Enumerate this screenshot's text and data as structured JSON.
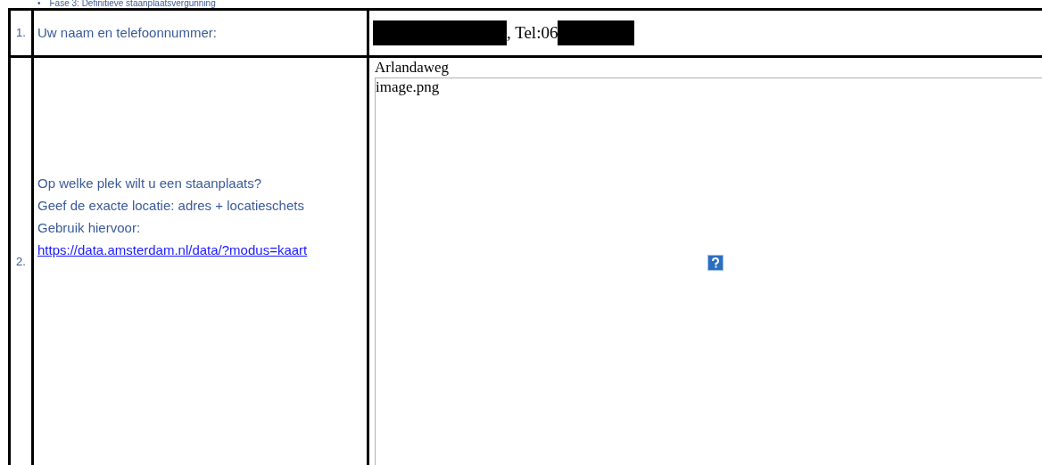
{
  "heading": {
    "bullet": "•",
    "text": "Fase 3: Definitieve staanplaatsvergunning"
  },
  "rows": [
    {
      "number": "1.",
      "question": [
        "Uw naam en telefoonnummer:"
      ],
      "answer": {
        "kind": "contact",
        "middle": ", Tel:06"
      }
    },
    {
      "number": "2.",
      "question": [
        "Op welke plek wilt u een staanplaats?",
        "Geef de exacte locatie: adres + locatieschets",
        "Gebruik hiervoor:"
      ],
      "link": "https://data.amsterdam.nl/data/?modus=kaart",
      "answer": {
        "kind": "location",
        "address": "Arlandaweg",
        "image_name": "image.png"
      }
    }
  ]
}
